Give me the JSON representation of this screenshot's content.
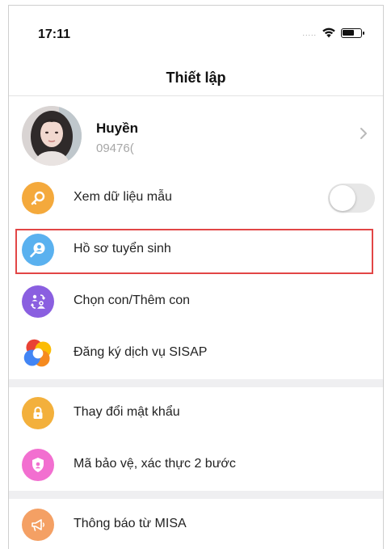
{
  "status_bar": {
    "time": "17:11",
    "signal": "....."
  },
  "header": {
    "title": "Thiết lập"
  },
  "profile": {
    "name": "Huyền",
    "phone": "09476("
  },
  "menu": {
    "demo_data": {
      "label": "Xem dữ liệu mẫu",
      "toggle_on": false,
      "icon": "key-search-icon",
      "color": "#f4a93c"
    },
    "admission": {
      "label": "Hồ sơ tuyển sinh",
      "icon": "user-search-icon",
      "color": "#5ab1ef"
    },
    "child": {
      "label": "Chọn con/Thêm con",
      "icon": "switch-child-icon",
      "color": "#8a5fe0"
    },
    "sisap": {
      "label": "Đăng ký dịch vụ SISAP",
      "icon": "sisap-logo-icon"
    },
    "password": {
      "label": "Thay đổi mật khẩu",
      "icon": "lock-icon",
      "color": "#f3b03c"
    },
    "two_factor": {
      "label": "Mã bảo vệ, xác thực 2 bước",
      "icon": "shield-icon",
      "color": "#f26fd0"
    },
    "misa": {
      "label": "Thông báo từ MISA",
      "icon": "megaphone-icon",
      "color": "#f4a064"
    }
  },
  "highlight_color": "#e24646"
}
